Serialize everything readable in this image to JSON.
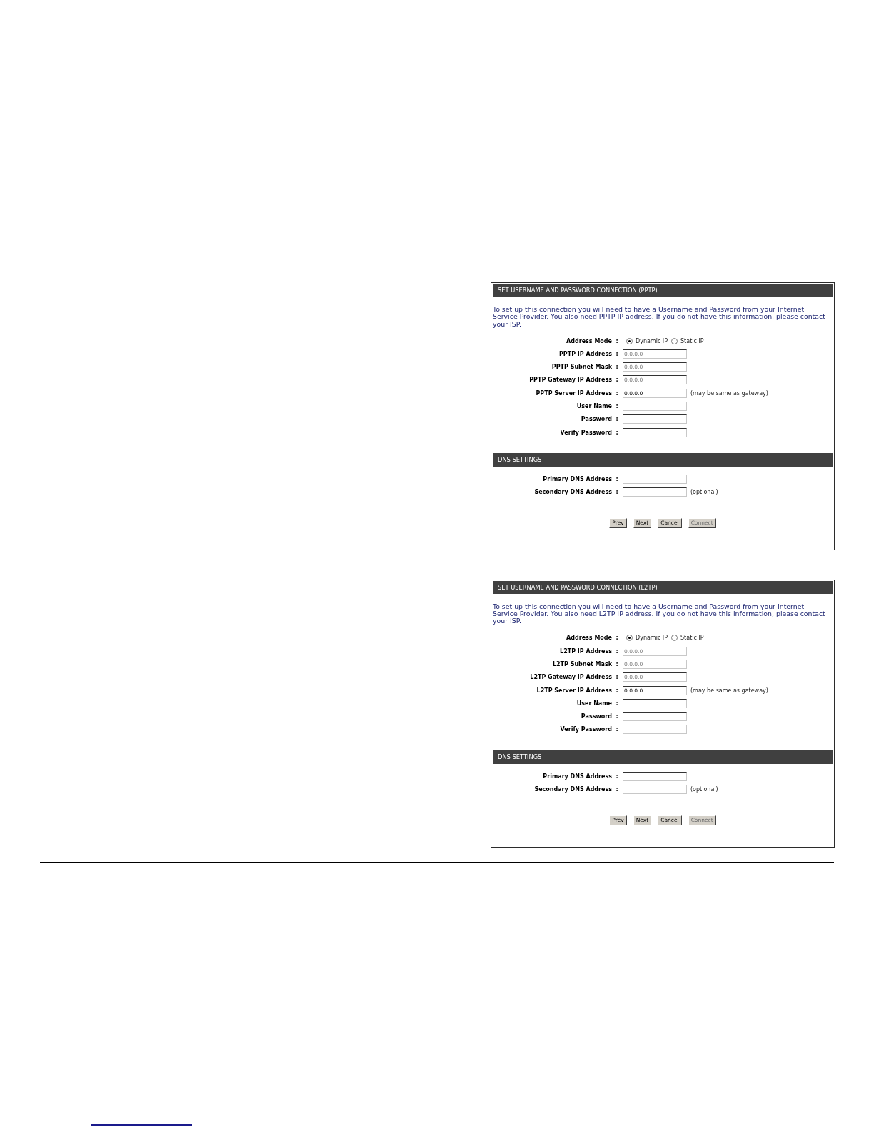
{
  "panels": [
    {
      "title": "SET USERNAME AND PASSWORD CONNECTION (PPTP)",
      "description": "To set up this connection you will need to have a Username and Password from your Internet Service Provider. You also need PPTP IP address. If you do not have this information, please contact your ISP.",
      "address_mode": {
        "label": "Address Mode",
        "separator": ":",
        "options": [
          {
            "label": "Dynamic IP",
            "selected": true
          },
          {
            "label": "Static IP",
            "selected": false
          }
        ]
      },
      "fields": [
        {
          "label": "PPTP IP Address",
          "separator": ":",
          "value": "0.0.0.0",
          "disabled": true
        },
        {
          "label": "PPTP Subnet Mask",
          "separator": ":",
          "value": "0.0.0.0",
          "disabled": true
        },
        {
          "label": "PPTP Gateway IP Address",
          "separator": ":",
          "value": "0.0.0.0",
          "disabled": true
        },
        {
          "label": "PPTP Server IP Address",
          "separator": ":",
          "value": "0.0.0.0",
          "disabled": false,
          "note": "(may be same as gateway)"
        },
        {
          "label": "User Name",
          "separator": ":"
        },
        {
          "label": "Password",
          "separator": ":"
        },
        {
          "label": "Verify Password",
          "separator": ":"
        }
      ],
      "dns": {
        "title": "DNS SETTINGS",
        "fields": [
          {
            "label": "Primary DNS Address",
            "separator": ":"
          },
          {
            "label": "Secondary DNS Address",
            "separator": ":",
            "note": "(optional)"
          }
        ]
      },
      "buttons": [
        {
          "label": "Prev",
          "disabled": false
        },
        {
          "label": "Next",
          "disabled": false
        },
        {
          "label": "Cancel",
          "disabled": false
        },
        {
          "label": "Connect",
          "disabled": true
        }
      ]
    },
    {
      "title": "SET USERNAME AND PASSWORD CONNECTION (L2TP)",
      "description": "To set up this connection you will need to have a Username and Password from your Internet Service Provider. You also need L2TP IP address. If you do not have this information, please contact your ISP.",
      "address_mode": {
        "label": "Address Mode",
        "separator": ":",
        "options": [
          {
            "label": "Dynamic IP",
            "selected": true
          },
          {
            "label": "Static IP",
            "selected": false
          }
        ]
      },
      "fields": [
        {
          "label": "L2TP IP Address",
          "separator": ":",
          "value": "0.0.0.0",
          "disabled": true
        },
        {
          "label": "L2TP Subnet Mask",
          "separator": ":",
          "value": "0.0.0.0",
          "disabled": true
        },
        {
          "label": "L2TP Gateway IP Address",
          "separator": ":",
          "value": "0.0.0.0",
          "disabled": true
        },
        {
          "label": "L2TP Server IP Address",
          "separator": ":",
          "value": "0.0.0.0",
          "disabled": false,
          "note": "(may be same as gateway)"
        },
        {
          "label": "User Name",
          "separator": ":"
        },
        {
          "label": "Password",
          "separator": ":"
        },
        {
          "label": "Verify Password",
          "separator": ":"
        }
      ],
      "dns": {
        "title": "DNS SETTINGS",
        "fields": [
          {
            "label": "Primary DNS Address",
            "separator": ":"
          },
          {
            "label": "Secondary DNS Address",
            "separator": ":",
            "note": "(optional)"
          }
        ]
      },
      "buttons": [
        {
          "label": "Prev",
          "disabled": false
        },
        {
          "label": "Next",
          "disabled": false
        },
        {
          "label": "Cancel",
          "disabled": false
        },
        {
          "label": "Connect",
          "disabled": true
        }
      ]
    }
  ]
}
